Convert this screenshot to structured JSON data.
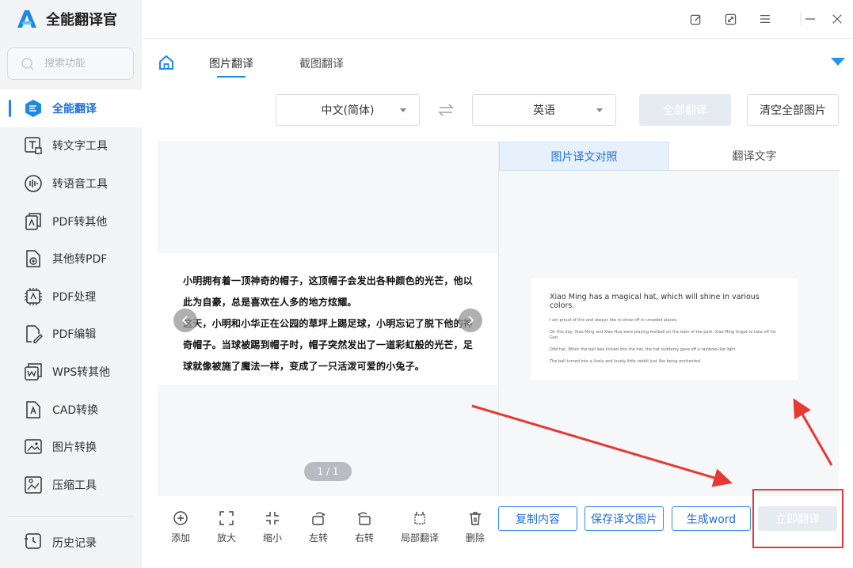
{
  "app": {
    "title": "全能翻译官"
  },
  "search": {
    "placeholder": "搜索功能"
  },
  "sidebar": {
    "items": [
      {
        "label": "全能翻译",
        "icon": "translate-icon",
        "active": true
      },
      {
        "label": "转文字工具",
        "icon": "text-convert-icon"
      },
      {
        "label": "转语音工具",
        "icon": "voice-icon"
      },
      {
        "label": "PDF转其他",
        "icon": "pdf-export-icon"
      },
      {
        "label": "其他转PDF",
        "icon": "pdf-import-icon"
      },
      {
        "label": "PDF处理",
        "icon": "pdf-process-icon"
      },
      {
        "label": "PDF编辑",
        "icon": "pdf-edit-icon"
      },
      {
        "label": "WPS转其他",
        "icon": "wps-icon"
      },
      {
        "label": "CAD转换",
        "icon": "cad-icon"
      },
      {
        "label": "图片转换",
        "icon": "image-convert-icon"
      },
      {
        "label": "压缩工具",
        "icon": "compress-icon"
      }
    ],
    "history_label": "历史记录"
  },
  "tabs": {
    "image_translate": "图片翻译",
    "screenshot_translate": "截图翻译"
  },
  "languages": {
    "source": "中文(简体)",
    "target": "英语"
  },
  "actions": {
    "translate_all": "全部翻译",
    "clear_all": "清空全部图片"
  },
  "source_text": {
    "lines": [
      "小明拥有着一顶神奇的帽子，这顶帽子会发出各种颜色的光芒，他以",
      "此为自豪，总是喜欢在人多的地方炫耀。",
      "这天，小明和小华正在公园的草坪上踢足球，小明忘记了脱下他的神",
      "奇帽子。当球被踢到帽子时，帽子突然发出了一道彩虹般的光芒，足",
      "球就像被施了魔法一样，变成了一只活泼可爱的小兔子。"
    ]
  },
  "pager": {
    "text": "1 / 1"
  },
  "result_tabs": {
    "compare": "图片译文对照",
    "text": "翻译文字"
  },
  "translated_text": {
    "title": "Xiao Ming has a magical hat, which will shine in various colors.",
    "lines": [
      "I am proud of this and always like to show off in crowded places.",
      "On this day, Xiao Ming and Xiao Hua were playing football on the lawn of the park. Xiao Ming forgot to take off his God",
      "Odd hat. When the ball was kicked into the hat, the hat suddenly gave off a rainbow-like light",
      "The ball turned into a lively and lovely little rabbit just like being enchanted."
    ]
  },
  "toolbar": {
    "add": "添加",
    "zoom_in": "放大",
    "zoom_out": "缩小",
    "rotate_left": "左转",
    "rotate_right": "右转",
    "partial_translate": "局部翻译",
    "delete": "删除"
  },
  "result_actions": {
    "copy": "复制内容",
    "save_image": "保存译文图片",
    "gen_word": "生成word",
    "translate_now": "立即翻译"
  },
  "colors": {
    "accent": "#1e88e5",
    "annotation": "#e53935",
    "disabled": "#e6ebf1"
  }
}
